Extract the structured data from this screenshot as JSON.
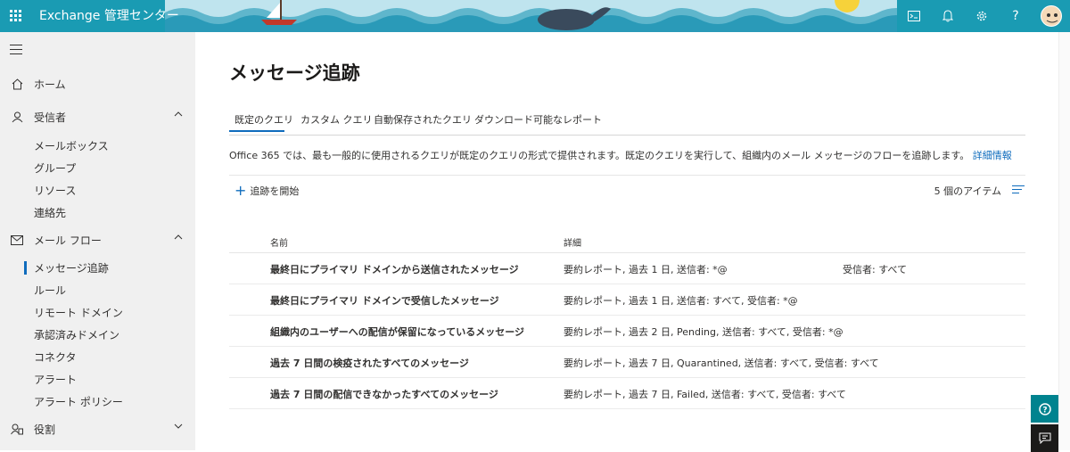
{
  "header": {
    "app_title": "Exchange 管理センター",
    "icons": [
      "waffle-icon",
      "terminal-icon",
      "bell-icon",
      "gear-icon",
      "help-icon",
      "avatar"
    ],
    "help_label": "?",
    "brand_color": "#1a9bb3"
  },
  "sidebar": {
    "home": "ホーム",
    "recipients": "受信者",
    "recipients_items": [
      "メールボックス",
      "グループ",
      "リソース",
      "連絡先"
    ],
    "mailflow": "メール フロー",
    "mailflow_items": [
      "メッセージ追跡",
      "ルール",
      "リモート ドメイン",
      "承認済みドメイン",
      "コネクタ",
      "アラート",
      "アラート ポリシー"
    ],
    "roles": "役割"
  },
  "main": {
    "title": "メッセージ追跡",
    "tabs": [
      "既定のクエリ",
      "カスタム クエリ",
      "自動保存されたクエリ",
      "ダウンロード可能なレポート"
    ],
    "description": "Office 365 では、最も一般的に使用されるクエリが既定のクエリの形式で提供されます。既定のクエリを実行して、組織内のメール メッセージのフローを追跡します。",
    "description_link": "詳細情報",
    "start_trace": "追跡を開始",
    "item_count": "5 個のアイテム",
    "columns": [
      "名前",
      "詳細"
    ],
    "rows": [
      {
        "name": "最終日にプライマリ ドメインから送信されたメッセージ",
        "detail": "要約レポート, 過去 1 日, 送信者: *@",
        "extra": "受信者: すべて"
      },
      {
        "name": "最終日にプライマリ ドメインで受信したメッセージ",
        "detail": "要約レポート, 過去 1 日, 送信者: すべて, 受信者: *@",
        "extra": ""
      },
      {
        "name": "組織内のユーザーへの配信が保留になっているメッセージ",
        "detail": "要約レポート, 過去 2 日, Pending, 送信者: すべて, 受信者: *@",
        "extra": ""
      },
      {
        "name": "過去 7 日間の検疫されたすべてのメッセージ",
        "detail": "要約レポート, 過去 7 日, Quarantined, 送信者: すべて, 受信者: すべて",
        "extra": ""
      },
      {
        "name": "過去 7 日間の配信できなかったすべてのメッセージ",
        "detail": "要約レポート, 過去 7 日, Failed, 送信者: すべて, 受信者: すべて",
        "extra": ""
      }
    ]
  }
}
